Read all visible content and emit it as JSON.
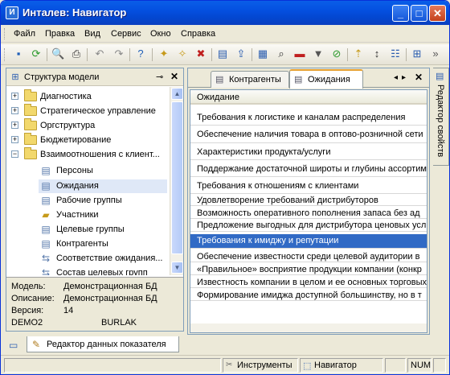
{
  "window": {
    "title": "Инталев: Навигатор"
  },
  "menu": [
    "Файл",
    "Правка",
    "Вид",
    "Сервис",
    "Окно",
    "Справка"
  ],
  "toolbar_icons": [
    "save-icon",
    "refresh-icon",
    "print-preview-icon",
    "print-icon",
    "undo-icon",
    "redo-icon",
    "help-icon",
    "new-item-icon",
    "new-child-icon",
    "delete-icon",
    "properties-icon",
    "export-icon",
    "table-icon",
    "search-icon",
    "minus-icon",
    "filter-icon",
    "clear-filter-icon",
    "move-up-icon",
    "sort-icon",
    "tree-icon",
    "tree-expand-icon"
  ],
  "left_panel": {
    "title": "Структура модели",
    "tree": [
      {
        "label": "Диагностика",
        "level": 0,
        "expander": "+",
        "icon": "folder"
      },
      {
        "label": "Стратегическое управление",
        "level": 0,
        "expander": "+",
        "icon": "folder"
      },
      {
        "label": "Оргструктура",
        "level": 0,
        "expander": "+",
        "icon": "folder"
      },
      {
        "label": "Бюджетирование",
        "level": 0,
        "expander": "+",
        "icon": "folder"
      },
      {
        "label": "Взаимоотношения с клиент...",
        "level": 0,
        "expander": "−",
        "icon": "folder"
      },
      {
        "label": "Персоны",
        "level": 1,
        "icon": "list"
      },
      {
        "label": "Ожидания",
        "level": 1,
        "icon": "list",
        "selected": true
      },
      {
        "label": "Рабочие группы",
        "level": 1,
        "icon": "list"
      },
      {
        "label": "Участники",
        "level": 1,
        "icon": "folder-small"
      },
      {
        "label": "Целевые группы",
        "level": 1,
        "icon": "list"
      },
      {
        "label": "Контрагенты",
        "level": 1,
        "icon": "list"
      },
      {
        "label": "Соответствие ожидания...",
        "level": 1,
        "icon": "link"
      },
      {
        "label": "Состав целевых групп",
        "level": 1,
        "icon": "link"
      }
    ],
    "info": [
      {
        "label": "Модель:",
        "value": "Демонстрационная БД"
      },
      {
        "label": "Описание:",
        "value": "Демонстрационная БД"
      },
      {
        "label": "Версия:",
        "value": "14"
      }
    ],
    "db_name": "DEMO2",
    "user": "BURLAK"
  },
  "bottom_tab": {
    "label": "Редактор данных показателя"
  },
  "tabs": [
    {
      "label": "Контрагенты",
      "active": false
    },
    {
      "label": "Ожидания",
      "active": true
    }
  ],
  "list": {
    "column": "Ожидание",
    "rows": [
      "Требования к логистике и каналам распределения",
      "Обеспечение наличия товара в оптово-розничной сети",
      "Характеристики продукта/услуги",
      "Поддержание достаточной широты и глубины ассортимента",
      "Требования к отношениям с клиентами",
      "Удовлетворение требований дистрибуторов",
      "Возможность оперативного пополнения запаса без ад",
      "Предложение выгодных для дистрибутора ценовых усл",
      "Требования к имиджу и репутации",
      "Обеспечение известности среди целевой аудитории в",
      "«Правильное» восприятие продукции компании (конкр",
      "Известность компании в целом и ее основных торговых",
      "Формирование имиджа доступной большинству, но в т"
    ],
    "selected_index": 8
  },
  "right_dock": {
    "label": "Редактор свойств"
  },
  "status": {
    "tools": "Инструменты",
    "navigator": "Навигатор",
    "num": "NUM"
  }
}
